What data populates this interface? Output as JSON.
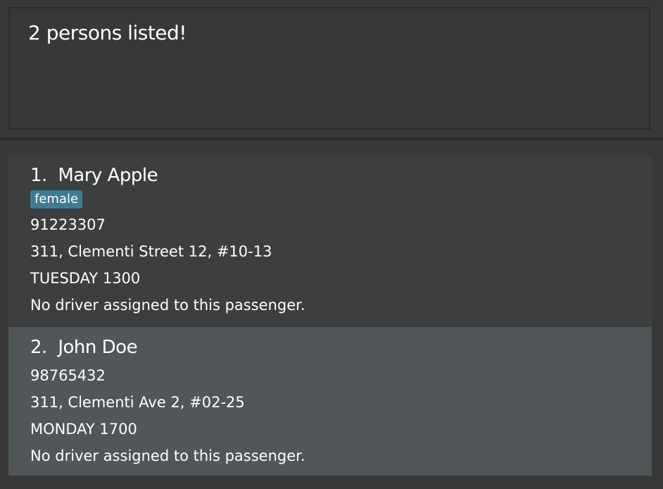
{
  "result": {
    "text": "2 persons listed!"
  },
  "persons": [
    {
      "index": "1.",
      "name": "Mary Apple",
      "tags": [
        "female"
      ],
      "phone": "91223307",
      "address": "311, Clementi Street 12, #10-13",
      "schedule": "TUESDAY 1300",
      "driver": "No driver assigned to this passenger."
    },
    {
      "index": "2.",
      "name": "John Doe",
      "tags": [],
      "phone": "98765432",
      "address": "311, Clementi Ave 2, #02-25",
      "schedule": "MONDAY 1700",
      "driver": "No driver assigned to this passenger."
    }
  ]
}
